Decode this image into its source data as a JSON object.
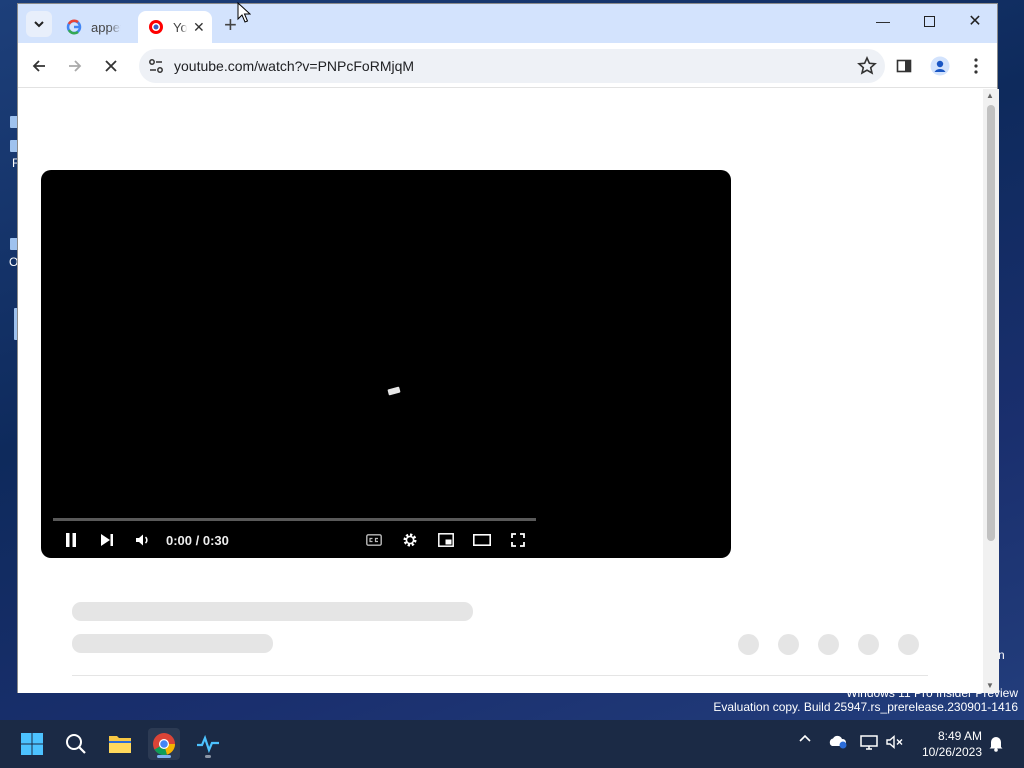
{
  "browser": {
    "tabs": [
      {
        "title": "appet",
        "favicon": "google-g-icon",
        "active": false
      },
      {
        "title": "Yo",
        "favicon": "youtube-icon",
        "active": true
      }
    ],
    "url": "youtube.com/watch?v=PNPcFoRMjqM"
  },
  "player": {
    "time_current": "0:00",
    "time_total": "0:30",
    "time_display": "0:00 / 0:30",
    "state": "playing",
    "progress": 0.0
  },
  "watermark": {
    "line1": "Windows 11 Pro Insider Preview",
    "line2": "Evaluation copy. Build 25947.rs_prerelease.230901-1416"
  },
  "desktop": {
    "partial_label_1": "F",
    "partial_label_2": "O",
    "partial_label_3": "n"
  },
  "taskbar": {
    "time": "8:49 AM",
    "date": "10/26/2023",
    "apps": [
      "start-icon",
      "search-icon",
      "file-explorer-icon",
      "chrome-icon",
      "activity-monitor-icon"
    ]
  },
  "colors": {
    "tabstrip": "#d3e3fd",
    "youtube_red": "#ff0000",
    "taskbar": "#1b2a45"
  }
}
